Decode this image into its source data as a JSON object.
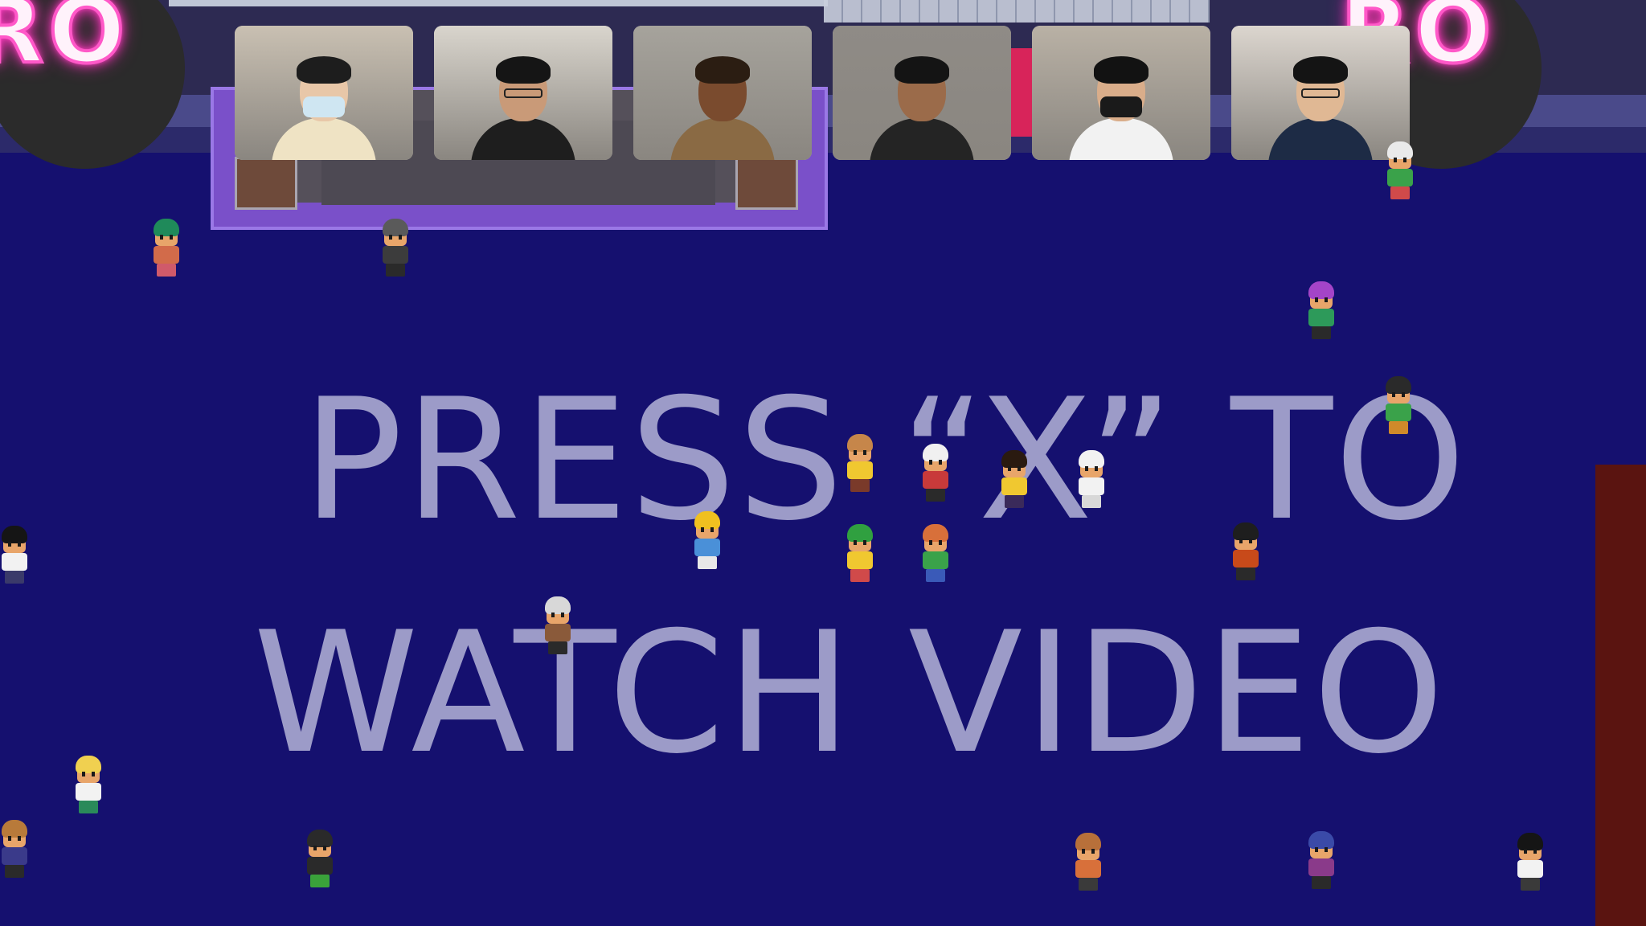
{
  "app": {
    "sign_line1": "PRESS “X” TO",
    "sign_line2": "WATCH VIDEO",
    "neon_left": "RO",
    "neon_right": "RO"
  },
  "video_tiles": [
    {
      "id": "participant-1",
      "bg": "#c9c0b2",
      "skin": "#e8c7a8",
      "hair": "#1d1d1d",
      "shirt": "#efe3c4",
      "mask": true
    },
    {
      "id": "participant-2",
      "bg": "#d9d5cd",
      "skin": "#c99a78",
      "hair": "#151515",
      "shirt": "#1e1e1e",
      "glasses": true
    },
    {
      "id": "participant-3",
      "bg": "#a6a39c",
      "skin": "#7a4b2e",
      "hair": "#2b1d12",
      "shirt": "#8a6a44"
    },
    {
      "id": "participant-4",
      "bg": "#8f8b86",
      "skin": "#9b6b4a",
      "hair": "#141414",
      "shirt": "#242424"
    },
    {
      "id": "participant-5",
      "bg": "#b9b1a5",
      "skin": "#d9ad8a",
      "hair": "#121212",
      "shirt": "#f2f2f2",
      "mask": true
    },
    {
      "id": "participant-6",
      "bg": "#dcd6cf",
      "skin": "#e0b894",
      "hair": "#141414",
      "shirt": "#1d2b45",
      "glasses": true
    }
  ],
  "avatars": [
    {
      "name": "avatar-green-leaf",
      "hair": "#1f8a5a",
      "shirt": "#d26b4a",
      "legs": "#d05a6a"
    },
    {
      "name": "avatar-helmet-gray",
      "hair": "#5a5a5a",
      "shirt": "#3c3c3c",
      "legs": "#2a2a2a"
    },
    {
      "name": "avatar-top-right",
      "hair": "#eaeaea",
      "shirt": "#3aa24a",
      "legs": "#d04a4a"
    },
    {
      "name": "avatar-purple-afro",
      "hair": "#a444c8",
      "shirt": "#2d9a5a",
      "legs": "#2a2a2a"
    },
    {
      "name": "avatar-black-cap",
      "hair": "#2a2a2a",
      "shirt": "#3aa24a",
      "legs": "#d08a2a"
    },
    {
      "name": "avatar-straw-hat",
      "hair": "#c6864a",
      "shirt": "#f0c830",
      "legs": "#7a3a2a"
    },
    {
      "name": "avatar-white-hair",
      "hair": "#f0f0f0",
      "shirt": "#c83a3a",
      "legs": "#2a2a2a"
    },
    {
      "name": "avatar-dark-yellow",
      "hair": "#2a1a10",
      "shirt": "#f0c830",
      "legs": "#3a2a5a"
    },
    {
      "name": "avatar-ghost",
      "hair": "#f2f2f2",
      "shirt": "#f2f2f2",
      "legs": "#d8d8d8"
    },
    {
      "name": "avatar-gold-crown",
      "hair": "#f0c020",
      "shirt": "#4a90d8",
      "legs": "#e8e8e8"
    },
    {
      "name": "avatar-green-hair",
      "hair": "#30a040",
      "shirt": "#f0c830",
      "legs": "#d04a4a"
    },
    {
      "name": "avatar-orange-hair",
      "hair": "#d8703a",
      "shirt": "#3aa24a",
      "legs": "#3a5ab8"
    },
    {
      "name": "avatar-black-helmet",
      "hair": "#1e1e1e",
      "shirt": "#c84a1a",
      "legs": "#2a2a2a"
    },
    {
      "name": "avatar-left-edge",
      "hair": "#151515",
      "shirt": "#f2f2f2",
      "legs": "#3a3a6a"
    },
    {
      "name": "avatar-bandana",
      "hair": "#d8d8d8",
      "shirt": "#8a5a3a",
      "legs": "#2a2a2a"
    },
    {
      "name": "avatar-blonde",
      "hair": "#f0d050",
      "shirt": "#f2f2f2",
      "legs": "#2a8a5a"
    },
    {
      "name": "avatar-hat-bottom-left",
      "hair": "#b87a3a",
      "shirt": "#3a3a8a",
      "legs": "#2a2a2a"
    },
    {
      "name": "avatar-officer-cap",
      "hair": "#2a2a2a",
      "shirt": "#2a2a2a",
      "legs": "#3aa23a"
    },
    {
      "name": "avatar-braids",
      "hair": "#b8703a",
      "shirt": "#d8703a",
      "legs": "#3a3a3a"
    },
    {
      "name": "avatar-headphones",
      "hair": "#3a4aa8",
      "shirt": "#8a3a8a",
      "legs": "#2a2a2a"
    },
    {
      "name": "avatar-bottom-right",
      "hair": "#151515",
      "shirt": "#f2f2f2",
      "legs": "#3a3a3a"
    }
  ],
  "colors": {
    "floor": "#15106f",
    "sign_text": "#9c9bc8",
    "neon_pink": "#ff3fc0",
    "wall_red": "#5a1410"
  }
}
